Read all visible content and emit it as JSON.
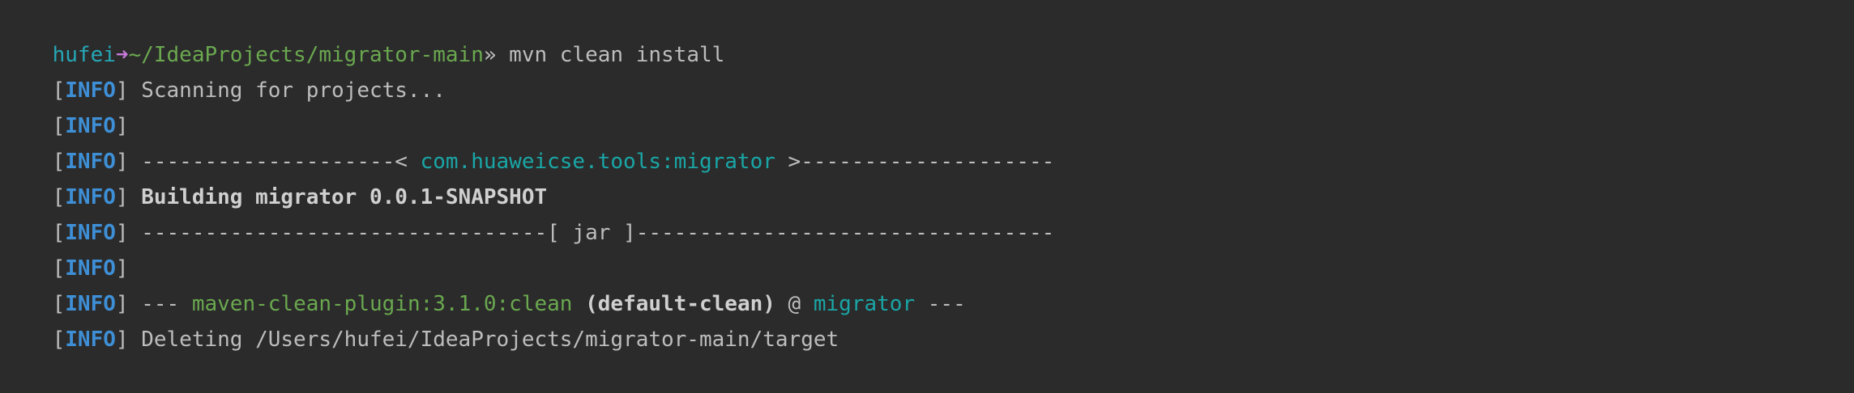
{
  "prompt": {
    "user": "hufei",
    "arrow": "➜",
    "cwd": "~/IdeaProjects/migrator-main",
    "separator": "»",
    "command": " mvn clean install"
  },
  "lines": [
    {
      "tag": "INFO",
      "text": " Scanning for projects..."
    },
    {
      "tag": "INFO",
      "text": ""
    },
    {
      "tag": "INFO",
      "prefix": " --------------------< ",
      "artifact": "com.huaweicse.tools:migrator",
      "suffix": " >--------------------"
    },
    {
      "tag": "INFO",
      "text": " Building migrator 0.0.1-SNAPSHOT"
    },
    {
      "tag": "INFO",
      "text": " --------------------------------[ jar ]---------------------------------"
    },
    {
      "tag": "INFO",
      "text": ""
    },
    {
      "tag": "INFO",
      "prefix": " --- ",
      "plugin": "maven-clean-plugin:3.1.0:clean",
      "exec_id": " (default-clean)",
      "at": " @ ",
      "project": "migrator",
      "suffix": " ---"
    },
    {
      "tag": "INFO",
      "text": " Deleting /Users/hufei/IdeaProjects/migrator-main/target"
    }
  ],
  "colors": {
    "background": "#2b2b2b",
    "text": "#bdbdbd",
    "info_tag": "#3e8fd6",
    "artifact": "#1aa6a6",
    "plugin": "#6aa84f",
    "prompt_user": "#26a7b7",
    "prompt_arrow": "#c77ad9",
    "prompt_path": "#6aa84f"
  }
}
